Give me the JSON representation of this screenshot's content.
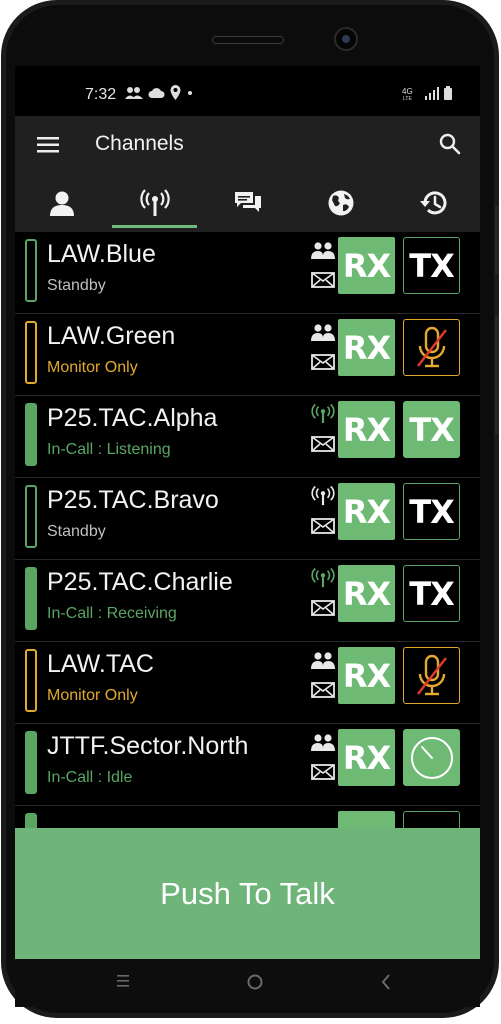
{
  "status_bar": {
    "time": "7:32",
    "network": "4G LTE"
  },
  "app_bar": {
    "title": "Channels"
  },
  "tabs": [
    {
      "name": "contacts",
      "icon": "person-icon",
      "active": false
    },
    {
      "name": "channels",
      "icon": "radio-tower-icon",
      "active": true
    },
    {
      "name": "messages",
      "icon": "chat-icon",
      "active": false
    },
    {
      "name": "map",
      "icon": "globe-icon",
      "active": false
    },
    {
      "name": "history",
      "icon": "history-icon",
      "active": false
    }
  ],
  "channels": [
    {
      "name": "LAW.Blue",
      "status": "Standby",
      "state": "standby",
      "status_color": "#bfbfbf",
      "indicator": "group-icon",
      "rx": "RX",
      "tx": "TX",
      "tx_state": "idle"
    },
    {
      "name": "LAW.Green",
      "status": "Monitor Only",
      "state": "monitor",
      "status_color": "#e3a92e",
      "indicator": "group-icon",
      "rx": "RX",
      "tx": "",
      "tx_state": "muted"
    },
    {
      "name": "P25.TAC.Alpha",
      "status": "In-Call : Listening",
      "state": "incall",
      "status_color": "#5aa563",
      "indicator": "radio-tower-icon",
      "rx": "RX",
      "tx": "TX",
      "tx_state": "active"
    },
    {
      "name": "P25.TAC.Bravo",
      "status": "Standby",
      "state": "standby",
      "status_color": "#bfbfbf",
      "indicator": "radio-tower-icon",
      "rx": "RX",
      "tx": "TX",
      "tx_state": "idle"
    },
    {
      "name": "P25.TAC.Charlie",
      "status": "In-Call : Receiving",
      "state": "incall",
      "status_color": "#5aa563",
      "indicator": "radio-tower-icon",
      "rx": "RX",
      "tx": "TX",
      "tx_state": "idle"
    },
    {
      "name": "LAW.TAC",
      "status": "Monitor Only",
      "state": "monitor",
      "status_color": "#e3a92e",
      "indicator": "group-icon",
      "rx": "RX",
      "tx": "",
      "tx_state": "muted"
    },
    {
      "name": "JTTF.Sector.North",
      "status": "In-Call : Idle",
      "state": "incall",
      "status_color": "#5aa563",
      "indicator": "group-icon",
      "rx": "RX",
      "tx": "",
      "tx_state": "timer"
    }
  ],
  "push_to_talk": {
    "label": "Push To Talk"
  },
  "colors": {
    "accent": "#6eba74",
    "monitor": "#e3a92e",
    "background": "#000000",
    "toolbar": "#202020"
  }
}
